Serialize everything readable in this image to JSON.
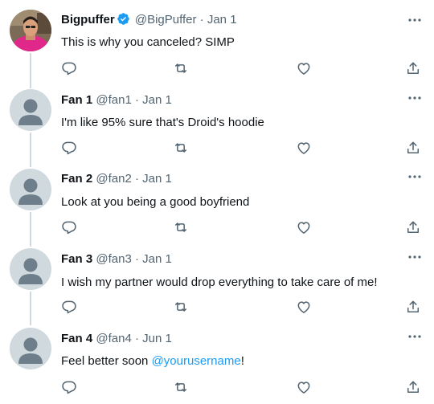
{
  "tweets": [
    {
      "name": "Bigpuffer",
      "verified": true,
      "handle": "@BigPuffer",
      "separator": "·",
      "date": "Jan 1",
      "text": "This is why you canceled? SIMP",
      "avatar": "photo-avatar-pink-hoodie"
    },
    {
      "name": "Fan 1",
      "verified": false,
      "handle": "@fan1",
      "separator": "·",
      "date": "Jan 1",
      "text": "I'm like 95% sure that's Droid's hoodie",
      "avatar": "default-avatar"
    },
    {
      "name": "Fan 2",
      "verified": false,
      "handle": "@fan2",
      "separator": "·",
      "date": "Jan 1",
      "text": "Look at you being a good boyfriend",
      "avatar": "default-avatar"
    },
    {
      "name": "Fan 3",
      "verified": false,
      "handle": "@fan3",
      "separator": "·",
      "date": "Jan 1",
      "text": "I wish my partner would drop everything to take care of me!",
      "avatar": "default-avatar"
    },
    {
      "name": "Fan 4",
      "verified": false,
      "handle": "@fan4",
      "separator": "·",
      "date": "Jun 1",
      "text_before": "Feel better soon ",
      "mention": "@yourusername",
      "text_after": "!",
      "avatar": "default-avatar"
    }
  ],
  "icons": {
    "reply": "reply-icon",
    "retweet": "retweet-icon",
    "like": "like-icon",
    "share": "share-icon",
    "more": "more-icon",
    "verified": "verified-badge-icon"
  },
  "colors": {
    "text": "#0f1419",
    "secondary": "#536471",
    "accent": "#1d9bf0",
    "thread_line": "#cfd9de",
    "avatar_bg": "#cfd9de",
    "avatar_fg": "#6e7e8a"
  }
}
